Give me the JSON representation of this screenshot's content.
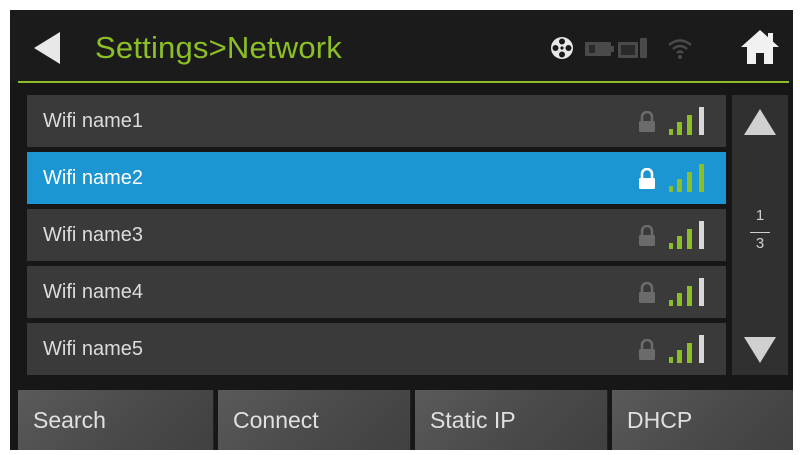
{
  "header": {
    "title": "Settings>Network",
    "accent_color": "#8cbf26",
    "icons": [
      "back-icon",
      "film-reel-icon",
      "battery-icon",
      "device-icon",
      "wifi-icon",
      "home-icon"
    ]
  },
  "networks": [
    {
      "label": "Wifi name1",
      "locked": true,
      "signal_bars": 4,
      "selected": false
    },
    {
      "label": "Wifi name2",
      "locked": true,
      "signal_bars": 4,
      "selected": true
    },
    {
      "label": "Wifi name3",
      "locked": true,
      "signal_bars": 4,
      "selected": false
    },
    {
      "label": "Wifi name4",
      "locked": true,
      "signal_bars": 4,
      "selected": false
    },
    {
      "label": "Wifi name5",
      "locked": true,
      "signal_bars": 4,
      "selected": false
    }
  ],
  "selection_color": "#1c96d3",
  "pagination": {
    "current": "1",
    "total": "3"
  },
  "buttons": {
    "search": "Search",
    "connect": "Connect",
    "static_ip": "Static IP",
    "dhcp": "DHCP"
  }
}
